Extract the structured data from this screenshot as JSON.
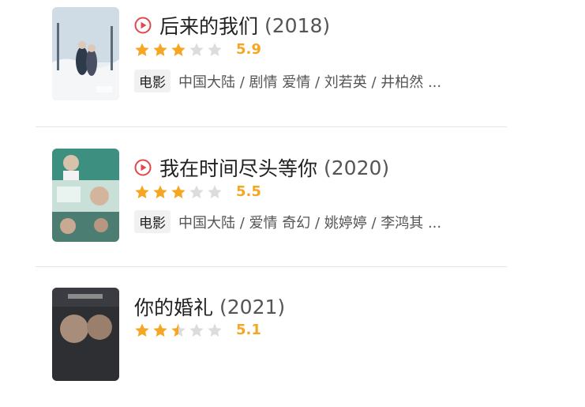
{
  "colors": {
    "star_on": "#f5a623",
    "star_off": "#dcdcdc",
    "score": "#f5a623",
    "play": "#e2474b"
  },
  "movies": [
    {
      "title": "后来的我们",
      "year": "(2018)",
      "has_play": true,
      "rating": 3,
      "score": "5.9",
      "type": "电影",
      "meta": "中国大陆 / 剧情 爱情 / 刘若英 / 井柏然 ..."
    },
    {
      "title": "我在时间尽头等你",
      "year": "(2020)",
      "has_play": true,
      "rating": 3,
      "score": "5.5",
      "type": "电影",
      "meta": "中国大陆 / 爱情 奇幻 / 姚婷婷 / 李鸿其 ..."
    },
    {
      "title": "你的婚礼",
      "year": "(2021)",
      "has_play": false,
      "rating": 2.5,
      "score": "5.1",
      "type": "",
      "meta": ""
    }
  ]
}
